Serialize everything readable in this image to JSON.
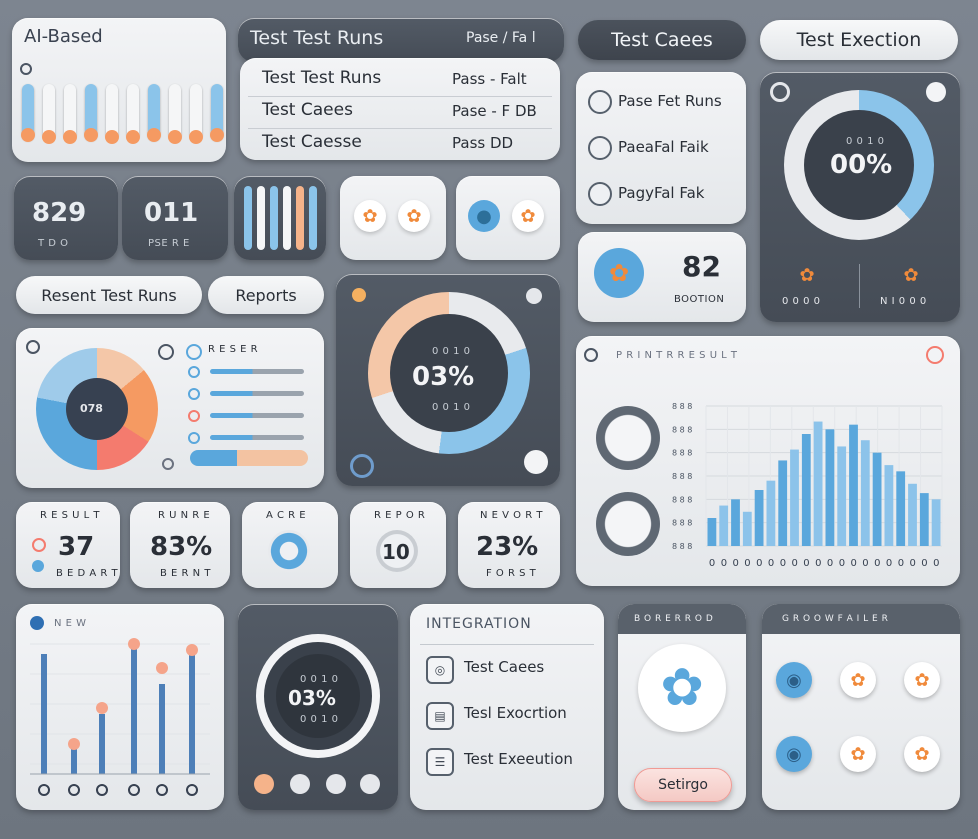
{
  "header": {
    "app_label": "AI-Based",
    "runs_title": "Test Test Runs",
    "runs_status": "Pase / Fa l",
    "tab_cases": "Test Caees",
    "tab_execution": "Test Exection"
  },
  "runs_table": [
    {
      "name": "Test Test Runs",
      "status": "Pass - Falt"
    },
    {
      "name": "Test Caees",
      "status": "Pase - F DB"
    },
    {
      "name": "Test Caesse",
      "status": "Pass  DD"
    }
  ],
  "metrics_top": [
    {
      "value": "829",
      "label": "T  D O"
    },
    {
      "value": "011",
      "label": "PSE R E"
    }
  ],
  "checklist": [
    {
      "label": "Pase Fet Runs"
    },
    {
      "label": "PaeaFal Faik"
    },
    {
      "label": "PagyFal Fak"
    }
  ],
  "gauge_top": {
    "value": "00%",
    "sub": "0 0 1 0"
  },
  "counter_card": {
    "value": "82",
    "label": "BOOTION"
  },
  "gauge_left_items": [
    "0 0 0 0",
    "N I 0  0 0"
  ],
  "nav": {
    "recent": "Resent Test Runs",
    "reports": "Reports"
  },
  "donut_card": {
    "center": "078",
    "legend_title": "R E S E R"
  },
  "gauge_center": {
    "value": "03%",
    "top": "0 0 1 0",
    "bottom": "0 0 1 0"
  },
  "chart_card": {
    "title": "P R I N T R   R E S U L T",
    "chart_data": {
      "type": "bar",
      "categories": [
        "0",
        "0",
        "0",
        "0",
        "0",
        "0",
        "0",
        "0",
        "0",
        "0",
        "0",
        "0",
        "0",
        "0",
        "0",
        "0",
        "0",
        "0",
        "0",
        "0"
      ],
      "values": [
        18,
        26,
        30,
        22,
        36,
        42,
        55,
        62,
        72,
        80,
        75,
        64,
        78,
        68,
        60,
        52,
        48,
        40,
        34,
        30
      ],
      "ylabels": [
        "8 8 8",
        "8 8 8",
        "8 8 8",
        "8 8 8",
        "8 8 8",
        "8 8 8",
        "8 8 8"
      ]
    }
  },
  "stat_cards": [
    {
      "title": "R E S U L T",
      "value": "37",
      "label": "B E D A R T"
    },
    {
      "title": "R U N R E",
      "value": "83%",
      "label": "B E R N T"
    },
    {
      "title": "A C R E",
      "value": ""
    },
    {
      "title": "R E P O R",
      "value": "10",
      "label": ""
    },
    {
      "title": "N E V O R T",
      "value": "23%",
      "label": "F O R S T"
    }
  ],
  "lollipop_card": {
    "title": "N E W"
  },
  "small_gauge": {
    "value": "03%",
    "top": "0 0 1 0",
    "bottom": "0 0 1 0"
  },
  "integration": {
    "title": "INTEGRATION",
    "items": [
      {
        "label": "Test Caees"
      },
      {
        "label": "Tesl Exocrtion"
      },
      {
        "label": "Test Exeeution"
      }
    ]
  },
  "settings_card": {
    "title": "B O R E R  R O D",
    "button": "Setirgo"
  },
  "grid_card": {
    "title": "G R O O W  F A I L E R"
  },
  "colors": {
    "accent_blue": "#5aa7dc",
    "accent_orange": "#f59a62",
    "dark_panel": "#4a515b"
  }
}
